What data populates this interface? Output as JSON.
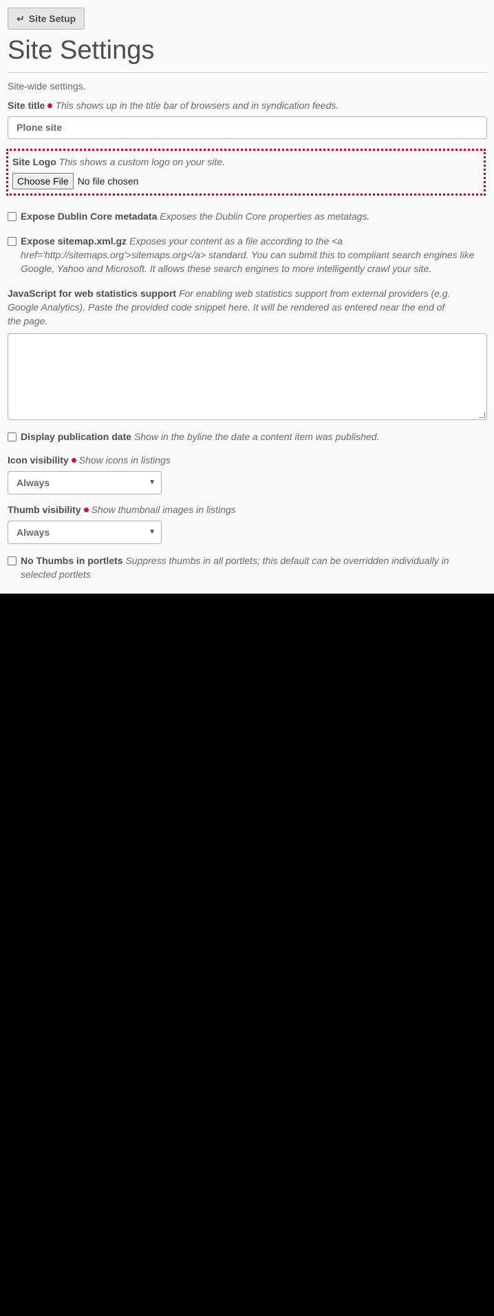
{
  "toolbar": {
    "setup_label": "Site Setup"
  },
  "page": {
    "title": "Site Settings",
    "description": "Site-wide settings."
  },
  "fields": {
    "site_title": {
      "label": "Site title",
      "help": "This shows up in the title bar of browsers and in syndication feeds.",
      "value": "Plone site"
    },
    "site_logo": {
      "label": "Site Logo",
      "help": "This shows a custom logo on your site.",
      "button": "Choose File",
      "status": "No file chosen"
    },
    "dublin_core": {
      "label": "Expose Dublin Core metadata",
      "help": "Exposes the Dublin Core properties as metatags."
    },
    "sitemap": {
      "label": "Expose sitemap.xml.gz",
      "help": "Exposes your content as a file according to the <a href='http://sitemaps.org'>sitemaps.org</a> standard. You can submit this to compliant search engines like Google, Yahoo and Microsoft. It allows these search engines to more intelligently crawl your site."
    },
    "webstats": {
      "label": "JavaScript for web statistics support",
      "help": "For enabling web statistics support from external providers (e.g. Google Analytics). Paste the provided code snippet here. It will be rendered as entered near the end of the page."
    },
    "pubdate": {
      "label": "Display publication date",
      "help": "Show in the byline the date a content item was published."
    },
    "icon_visibility": {
      "label": "Icon visibility",
      "help": "Show icons in listings",
      "value": "Always"
    },
    "thumb_visibility": {
      "label": "Thumb visibility",
      "help": "Show thumbnail images in listings",
      "value": "Always"
    },
    "no_thumbs_portlets": {
      "label": "No Thumbs in portlets",
      "help": "Suppress thumbs in all portlets; this default can be overridden individually in selected portlets"
    }
  }
}
